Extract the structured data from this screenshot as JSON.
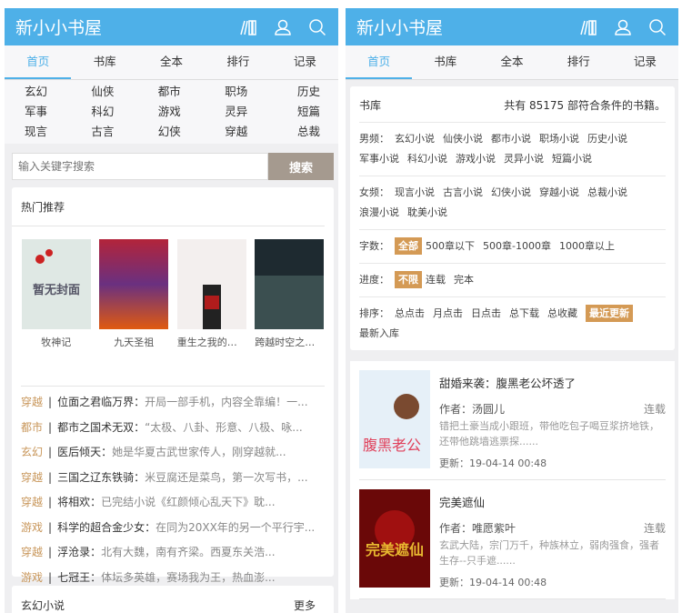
{
  "site_title": "新小小书屋",
  "icons": [
    "bookshelf-icon",
    "user-icon",
    "search-icon"
  ],
  "nav": [
    "首页",
    "书库",
    "全本",
    "排行",
    "记录"
  ],
  "categories": [
    "玄幻",
    "仙侠",
    "都市",
    "职场",
    "历史",
    "军事",
    "科幻",
    "游戏",
    "灵异",
    "短篇",
    "现言",
    "古言",
    "幻侠",
    "穿越",
    "总裁"
  ],
  "search": {
    "placeholder": "输入关键字搜索",
    "button": "搜索"
  },
  "hot": {
    "title": "热门推荐",
    "books": [
      "牧神记",
      "九天圣祖",
      "重生之我的兄...",
      "跨越时空之神..."
    ]
  },
  "list": [
    {
      "tag": "穿越",
      "name": "位面之君临万界：",
      "desc": "开局一部手机，内容全靠编！一..."
    },
    {
      "tag": "都市",
      "name": "都市之国术无双：",
      "desc": "“太极、八卦、形意、八极、咏..."
    },
    {
      "tag": "玄幻",
      "name": "医后倾天：",
      "desc": "她是华夏古武世家传人，刚穿越就..."
    },
    {
      "tag": "穿越",
      "name": "三国之辽东铁骑：",
      "desc": "米豆腐还是菜鸟，第一次写书，..."
    },
    {
      "tag": "穿越",
      "name": "将相欢：",
      "desc": "已完结小说《红颜倾心乱天下》耽..."
    },
    {
      "tag": "游戏",
      "name": "科学的超合金少女：",
      "desc": "在同为20XX年的另一个平行宇..."
    },
    {
      "tag": "穿越",
      "name": "浮沧录：",
      "desc": "北有大魏，南有齐梁。西夏东关浩..."
    },
    {
      "tag": "游戏",
      "name": "七冠王：",
      "desc": "体坛多英雄，赛场我为王，热血澎..."
    }
  ],
  "section2": {
    "title": "玄幻小说",
    "more": "更多"
  },
  "library": {
    "title": "书库",
    "count_text": "共有 85175 部符合条件的书籍。",
    "male_label": "男频：",
    "male": [
      "玄幻小说",
      "仙侠小说",
      "都市小说",
      "职场小说",
      "历史小说",
      "军事小说",
      "科幻小说",
      "游戏小说",
      "灵异小说",
      "短篇小说"
    ],
    "female_label": "女频：",
    "female": [
      "现言小说",
      "古言小说",
      "幻侠小说",
      "穿越小说",
      "总裁小说",
      "浪漫小说",
      "耽美小说"
    ],
    "words_label": "字数：",
    "words": [
      "全部",
      "500章以下",
      "500章-1000章",
      "1000章以上"
    ],
    "progress_label": "进度：",
    "progress": [
      "不限",
      "连载",
      "完本"
    ],
    "sort_label": "排序：",
    "sort": [
      "总点击",
      "月点击",
      "日点击",
      "总下载",
      "总收藏",
      "最近更新",
      "最新入库"
    ]
  },
  "results": [
    {
      "title": "甜婚来袭：腹黑老公坏透了",
      "author": "作者：汤圆儿",
      "status": "连载",
      "desc": "错把土豪当成小跟班，带他吃包子喝豆浆挤地铁，还带他跳墙逃票探......",
      "updated": "更新：19-04-14 00:48"
    },
    {
      "title": "完美遮仙",
      "author": "作者：唯愿紫叶",
      "status": "连载",
      "desc": "玄武大陆，宗门万千，种族林立，弱肉强食，强者生存--只手遮......",
      "updated": "更新：19-04-14 00:48"
    }
  ],
  "colors": {
    "header": "#4eb0e8",
    "accent": "#d49a55",
    "tag": "#c8965a"
  }
}
